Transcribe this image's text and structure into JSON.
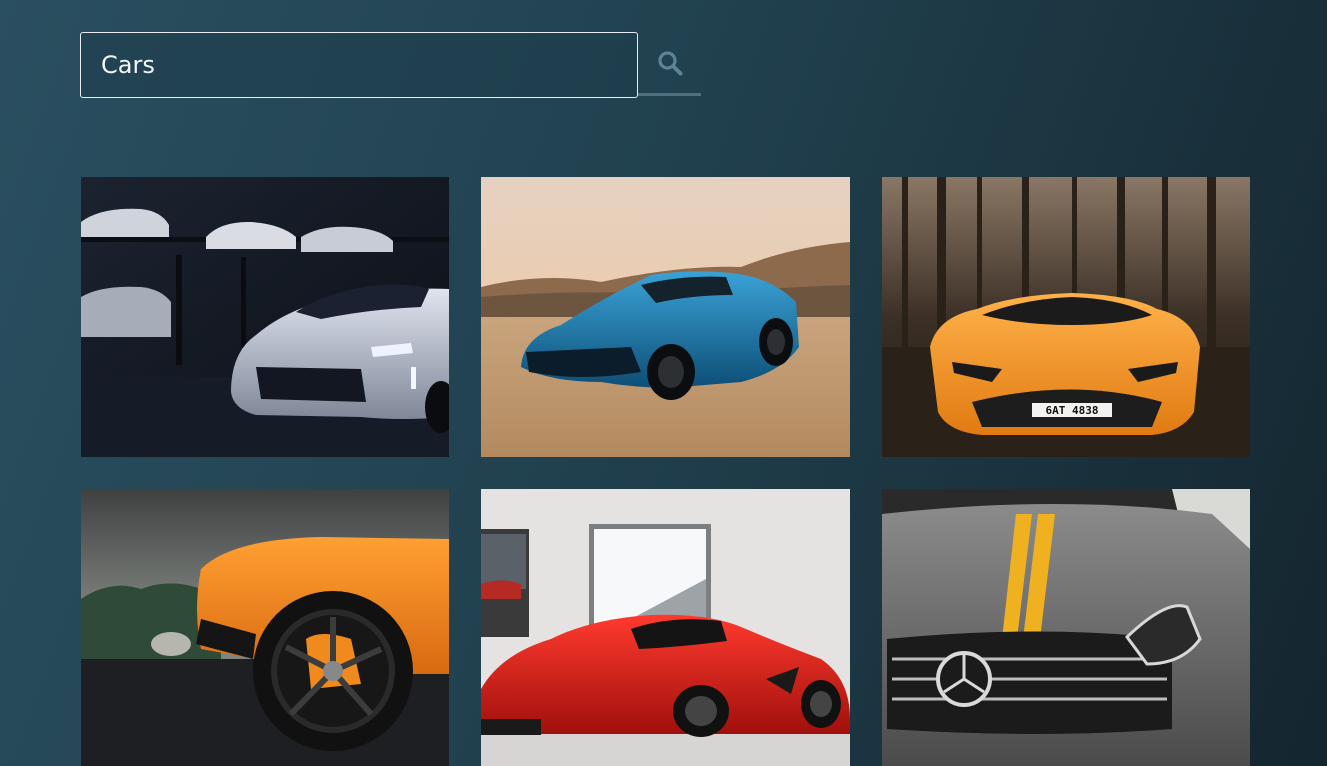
{
  "search": {
    "value": "Cars",
    "icon": "search-icon"
  },
  "gallery": {
    "items": [
      {
        "subject": "white-camaro-garage"
      },
      {
        "subject": "blue-camaro-desert"
      },
      {
        "subject": "orange-lamborghini-forest",
        "plate": "6AT 4838"
      },
      {
        "subject": "orange-lamborghini-wheel"
      },
      {
        "subject": "red-laferrari-showroom"
      },
      {
        "subject": "grey-mercedes-hood"
      }
    ]
  }
}
